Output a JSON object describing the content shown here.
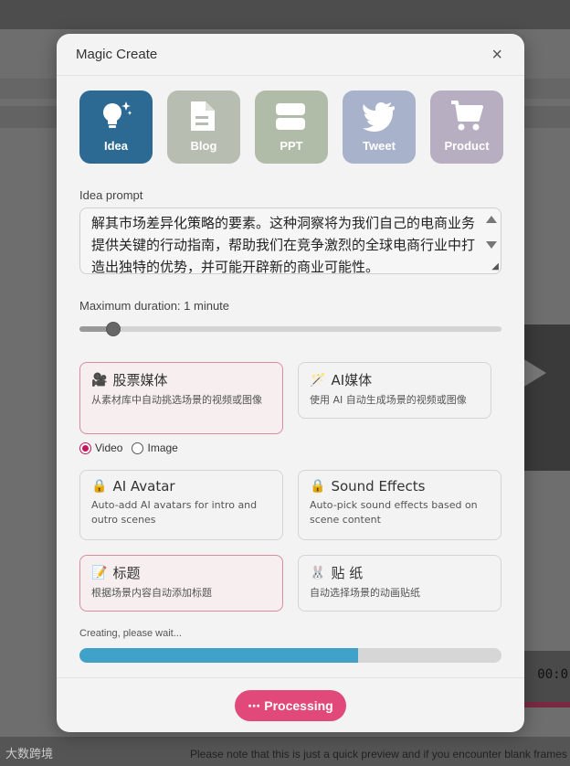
{
  "background": {
    "time": "00:0",
    "logo_text": "大数跨境",
    "notice": "Please note that this is just a quick preview and if you encounter blank frames"
  },
  "modal": {
    "title": "Magic Create",
    "close": "×"
  },
  "tiles": [
    {
      "label": "Idea",
      "icon": "lightbulb-icon"
    },
    {
      "label": "Blog",
      "icon": "document-icon"
    },
    {
      "label": "PPT",
      "icon": "slides-icon"
    },
    {
      "label": "Tweet",
      "icon": "bird-icon"
    },
    {
      "label": "Product",
      "icon": "cart-icon"
    }
  ],
  "prompt": {
    "label": "Idea prompt",
    "value": "解其市场差异化策略的要素。这种洞察将为我们自己的电商业务提供关键的行动指南，帮助我们在竞争激烈的全球电商行业中打造出独特的优势，并可能开辟新的商业可能性。"
  },
  "duration": {
    "label": "Maximum duration: 1 minute",
    "fraction": 0.08
  },
  "options": {
    "stock_media": {
      "icon": "🎥",
      "title": "股票媒体",
      "desc": "从素材库中自动挑选场景的视频或图像"
    },
    "ai_media": {
      "icon": "🪄",
      "title": "AI媒体",
      "desc": "使用 AI 自动生成场景的视频或图像"
    },
    "ai_avatar": {
      "icon": "🔒",
      "title": "AI Avatar",
      "desc": "Auto-add AI avatars for intro and outro scenes"
    },
    "sound_effects": {
      "icon": "🔒",
      "title": "Sound Effects",
      "desc": "Auto-pick sound effects based on scene content"
    },
    "captions": {
      "icon": "📝",
      "title": "标题",
      "desc": "根据场景内容自动添加标题"
    },
    "stickers": {
      "icon": "🐰",
      "title": "贴 纸",
      "desc": "自动选择场景的动画贴纸"
    }
  },
  "media_type": {
    "video": "Video",
    "image": "Image",
    "selected": "Video"
  },
  "progress": {
    "status": "Creating, please wait...",
    "fraction": 0.66
  },
  "footer": {
    "button_label": "Processing",
    "button_icon": "⋯"
  },
  "colors": {
    "accent": "#e0497a",
    "progress": "#40a2c8",
    "idea_tile": "#2c6a93"
  }
}
